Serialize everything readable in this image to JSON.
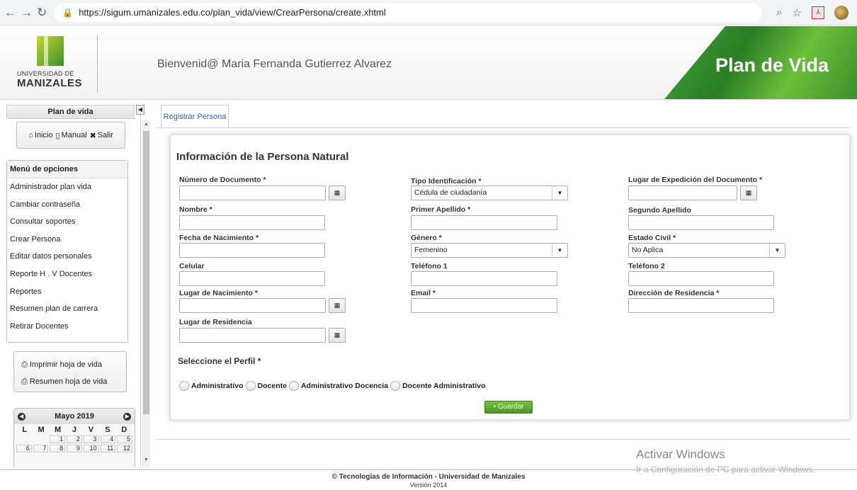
{
  "browser": {
    "url": "https://sigum.umanizales.edu.co/plan_vida/view/CrearPersona/create.xhtml",
    "icons": [
      "back-icon",
      "forward-icon",
      "reload-icon",
      "lock-icon",
      "zoom-icon",
      "star-icon",
      "pdf-icon",
      "avatar",
      "menu-dots-icon"
    ]
  },
  "header": {
    "logo_line1": "UNIVERSIDAD DE",
    "logo_line2": "MANIZALES",
    "welcome": "Bienvenid@ Maria Fernanda Gutierrez Alvarez",
    "banner_title": "Plan de Vida"
  },
  "sidebar": {
    "title": "Plan de vida",
    "quick": {
      "home": "Inicio",
      "manual": "Manual",
      "exit": "Salir"
    },
    "menu_title": "Menú de opciones",
    "menu_items": [
      "Administrador plan vida",
      "Cambiar contraseña",
      "Consultar soportes",
      "Crear Persona",
      "Editar datos personales",
      "Reporte H . V Docentes",
      "Reportes",
      "Resumen plan de carrera",
      "Retirar Docentes"
    ],
    "print_items": [
      "Imprimir hoja de vida",
      "Resumen hoja de vida"
    ],
    "calendar": {
      "month": "Mayo 2019",
      "days": [
        "L",
        "M",
        "M",
        "J",
        "V",
        "S",
        "D"
      ],
      "row1": [
        "",
        "",
        "1",
        "2",
        "3",
        "4",
        "5"
      ],
      "row2": [
        "6",
        "7",
        "8",
        "9",
        "10",
        "11",
        "12"
      ]
    }
  },
  "main": {
    "tab": "Registrar Persona",
    "form_title": "Información de la Persona Natural",
    "labels": {
      "numero_doc": "Número de Documento *",
      "tipo_id": "Tipo Identificación *",
      "lugar_exp": "Lugar de Expedición del Documento *",
      "nombre": "Nombre *",
      "primer_apellido": "Primer Apellido *",
      "segundo_apellido": "Segundo Apellido",
      "fecha_nac": "Fecha de Nacimiento *",
      "genero": "Género *",
      "estado_civil": "Estado Civil *",
      "celular": "Celular",
      "telefono1": "Teléfono 1",
      "telefono2": "Teléfono 2",
      "lugar_nac": "Lugar de Nacimiento *",
      "email": "Email *",
      "direccion": "Dirección de Residencia *",
      "lugar_res": "Lugar de Residencia"
    },
    "values": {
      "tipo_id": "Cédula de ciudadanía",
      "genero": "Femenino",
      "estado_civil": "No Aplica"
    },
    "perfil_title": "Seleccione el Perfil *",
    "perfil_options": [
      "Administrativo",
      "Docente",
      "Administrativo Docencia",
      "Docente Administrativo"
    ],
    "save_label": "Guardar"
  },
  "overlay": {
    "activate1": "Activar Windows",
    "activate2": "Ir a Configuración de PC para activar Windows."
  },
  "footer": {
    "line1": "© Tecnologías de Información - Universidad de Manizales",
    "line2": "Versión 2014"
  }
}
